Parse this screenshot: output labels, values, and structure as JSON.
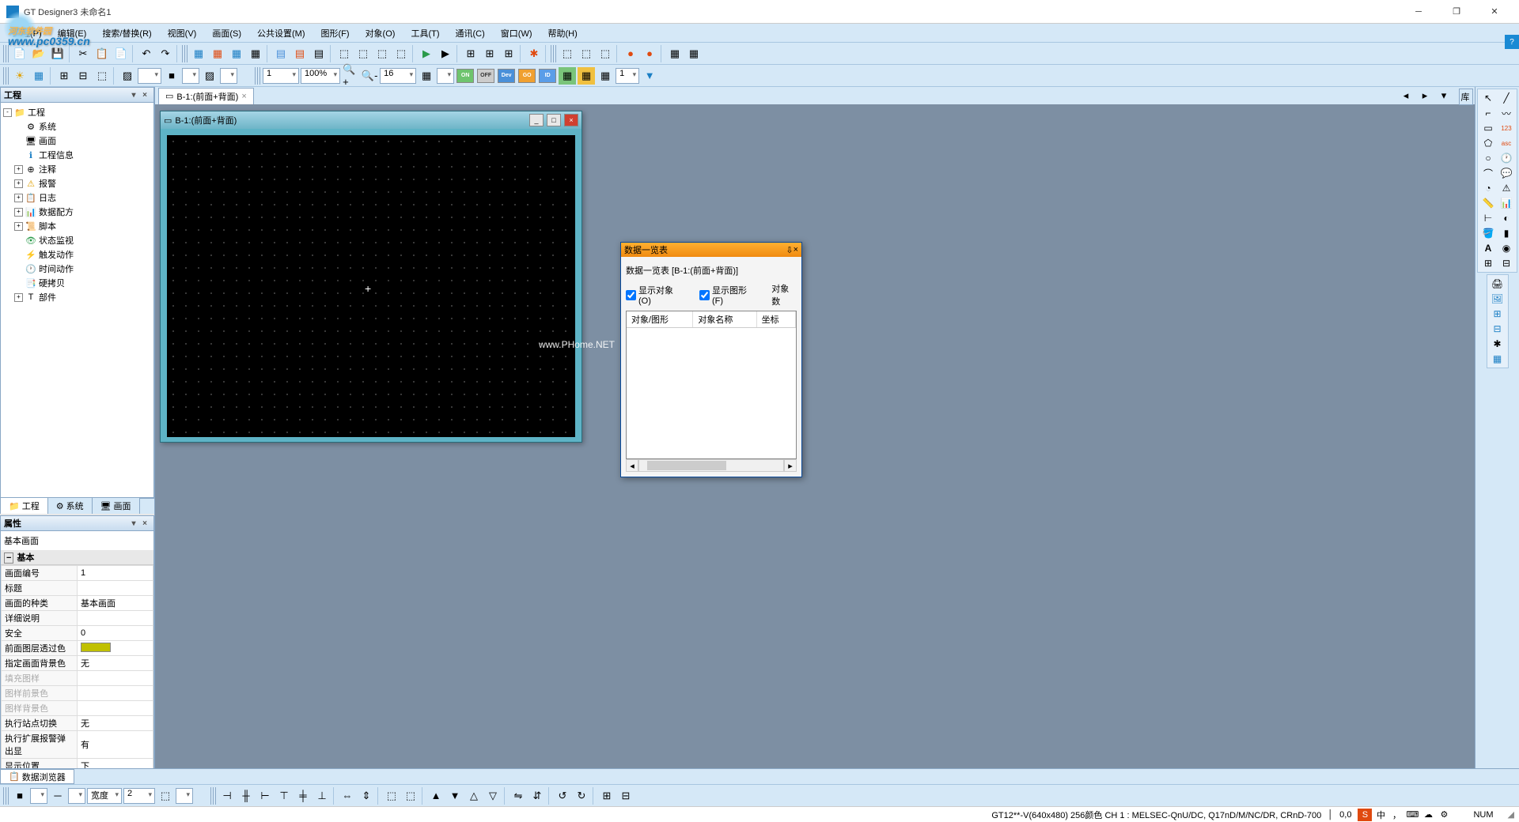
{
  "app": {
    "title": "GT Designer3 未命名1"
  },
  "watermark": {
    "main": "河东软件园",
    "sub": "www.pc0359.cn"
  },
  "menubar": [
    "工程(P)",
    "编辑(E)",
    "搜索/替换(R)",
    "视图(V)",
    "画面(S)",
    "公共设置(M)",
    "图形(F)",
    "对象(O)",
    "工具(T)",
    "通讯(C)",
    "窗口(W)",
    "帮助(H)"
  ],
  "toolbar1_combo1": "1",
  "toolbar1_combo2": "100%",
  "toolbar1_combo3": "16",
  "toolbar1_combo4": "1",
  "toggles": {
    "on": "ON",
    "off": "OFF",
    "dev": "Dev",
    "go": "GO",
    "id": "ID"
  },
  "project_panel": {
    "title": "工程"
  },
  "tree": [
    {
      "icon": "📁",
      "label": "工程",
      "exp": "-",
      "depth": 0
    },
    {
      "icon": "⚙",
      "label": "系统",
      "depth": 1
    },
    {
      "icon": "🖥",
      "label": "画面",
      "depth": 1
    },
    {
      "icon": "ℹ",
      "label": "工程信息",
      "depth": 1,
      "ic_color": "#1a7ec4"
    },
    {
      "icon": "⊕",
      "label": "注释",
      "depth": 1,
      "exp": "+"
    },
    {
      "icon": "⚠",
      "label": "报警",
      "depth": 1,
      "exp": "+",
      "ic_color": "#e0a000"
    },
    {
      "icon": "📋",
      "label": "日志",
      "depth": 1,
      "exp": "+"
    },
    {
      "icon": "📊",
      "label": "数据配方",
      "depth": 1,
      "exp": "+"
    },
    {
      "icon": "📜",
      "label": "脚本",
      "depth": 1,
      "exp": "+"
    },
    {
      "icon": "👁",
      "label": "状态监视",
      "depth": 1,
      "ic_color": "#2a9a4a"
    },
    {
      "icon": "⚡",
      "label": "触发动作",
      "depth": 1,
      "ic_color": "#e04a10"
    },
    {
      "icon": "🕐",
      "label": "时间动作",
      "depth": 1,
      "ic_color": "#2a7ac4"
    },
    {
      "icon": "📑",
      "label": "硬拷贝",
      "depth": 1
    },
    {
      "icon": "T",
      "label": "部件",
      "depth": 1,
      "exp": "+"
    }
  ],
  "left_tabs": [
    {
      "icon": "📁",
      "label": "工程",
      "active": true
    },
    {
      "icon": "⚙",
      "label": "系统"
    },
    {
      "icon": "🖥",
      "label": "画面"
    }
  ],
  "props_panel": {
    "title": "属性",
    "subtitle": "基本画面",
    "cat": "基本"
  },
  "props": [
    {
      "k": "画面编号",
      "v": "1"
    },
    {
      "k": "标题",
      "v": ""
    },
    {
      "k": "画面的种类",
      "v": "基本画面"
    },
    {
      "k": "详细说明",
      "v": ""
    },
    {
      "k": "安全",
      "v": "0"
    },
    {
      "k": "前面图层透过色",
      "v": "",
      "swatch": true
    },
    {
      "k": "指定画面背景色",
      "v": "无"
    },
    {
      "k": "填充图样",
      "v": "",
      "disabled": true
    },
    {
      "k": "图样前景色",
      "v": "",
      "disabled": true
    },
    {
      "k": "图样背景色",
      "v": "",
      "disabled": true
    },
    {
      "k": "执行站点切换",
      "v": "无"
    },
    {
      "k": "执行扩展报警弹出显",
      "v": "有"
    },
    {
      "k": "显示位置",
      "v": "下"
    }
  ],
  "doc_tab": {
    "label": "B-1:(前面+背面)"
  },
  "mdi": {
    "title": "B-1:(前面+背面)"
  },
  "canvas_wm": "www.PHome.NET",
  "float": {
    "title": "数据一览表",
    "info": "数据一览表        [B-1:(前面+背面)]",
    "chk1": "显示对象(O)",
    "chk2": "显示图形(F)",
    "countlbl": "对象数",
    "cols": [
      "对象/图形",
      "对象名称",
      "坐标"
    ]
  },
  "bottom_tab": {
    "icon": "📋",
    "label": "数据浏览器"
  },
  "bottom_combo1": "宽度",
  "bottom_combo2": "2",
  "sidevert": "库",
  "status": {
    "info": "GT12**-V(640x480)  256颜色  CH 1 : MELSEC-QnU/DC, Q17nD/M/NC/DR, CRnD-700",
    "coord": "0,0",
    "num": "NUM",
    "ime_s": "S",
    "ime_cn": "中"
  }
}
